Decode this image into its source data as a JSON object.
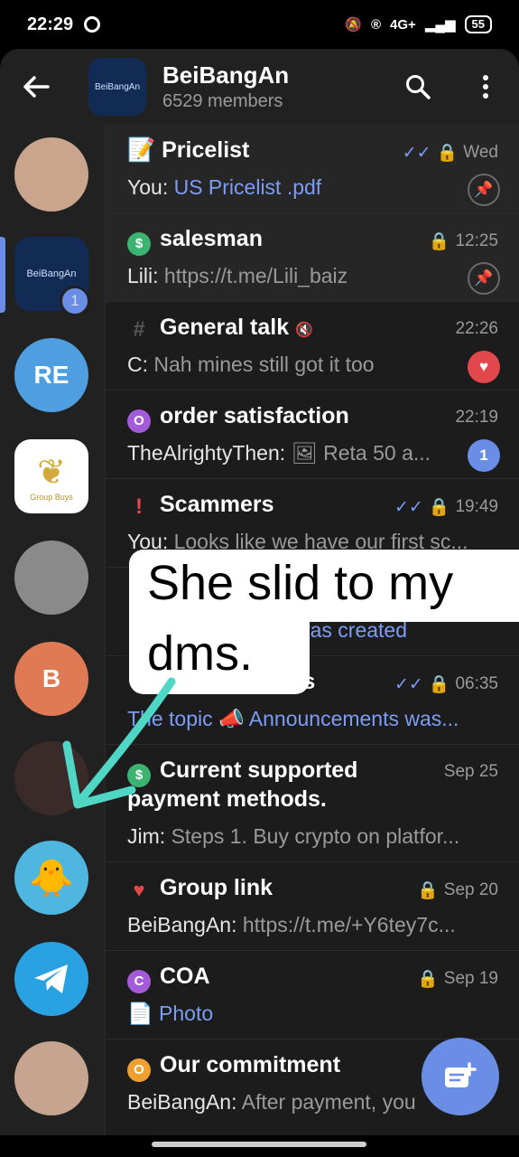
{
  "status": {
    "time": "22:29",
    "network": "4G+",
    "battery": "55"
  },
  "header": {
    "title": "BeiBangAn",
    "subtitle": "6529 members",
    "avatar_text": "BeiBangAn"
  },
  "sidebar": {
    "items": [
      {
        "label": ""
      },
      {
        "label": "BeiBangAn",
        "badge": "1"
      },
      {
        "label": "RE"
      },
      {
        "label": "Group Buys"
      },
      {
        "label": ""
      },
      {
        "label": "B"
      },
      {
        "label": ""
      },
      {
        "label": ""
      },
      {
        "label": ""
      },
      {
        "label": ""
      }
    ]
  },
  "chats": [
    {
      "icon": "📝",
      "title": "Pricelist",
      "time": "Wed",
      "sender": "You:",
      "message": "US Pricelist .pdf"
    },
    {
      "icon": "$",
      "title": "salesman",
      "time": "12:25",
      "sender": "Lili:",
      "message": "https://t.me/Lili_baiz"
    },
    {
      "icon": "#",
      "title": "General talk",
      "time": "22:26",
      "sender": "C:",
      "message": "Nah mines still got it too"
    },
    {
      "icon": "O",
      "title": "order satisfaction",
      "time": "22:19",
      "sender": "TheAlrightyThen:",
      "message": "Reta 50 a...",
      "badge": "1"
    },
    {
      "icon": "!",
      "title": "Scammers",
      "time": "19:49",
      "sender": "You:",
      "message": "Looks like we have our first sc..."
    },
    {
      "message": "was created"
    },
    {
      "title": "ts",
      "time": "06:35",
      "sender": "The topic",
      "message": "Announcements was..."
    },
    {
      "icon": "$",
      "title": "Current supported",
      "title2": "payment methods.",
      "time": "Sep 25",
      "sender": "Jim:",
      "message": "Steps 1. Buy crypto on platfor..."
    },
    {
      "icon": "♥",
      "title": "Group link",
      "time": "Sep 20",
      "sender": "BeiBangAn:",
      "message": "https://t.me/+Y6tey7c..."
    },
    {
      "icon": "C",
      "title": "COA",
      "time": "Sep 19",
      "message": "Photo"
    },
    {
      "icon": "O",
      "title": "Our commitment",
      "sender": "BeiBangAn:",
      "message": "After payment, you"
    }
  ],
  "overlay": {
    "line1": "She slid to my",
    "line2": "dms."
  }
}
